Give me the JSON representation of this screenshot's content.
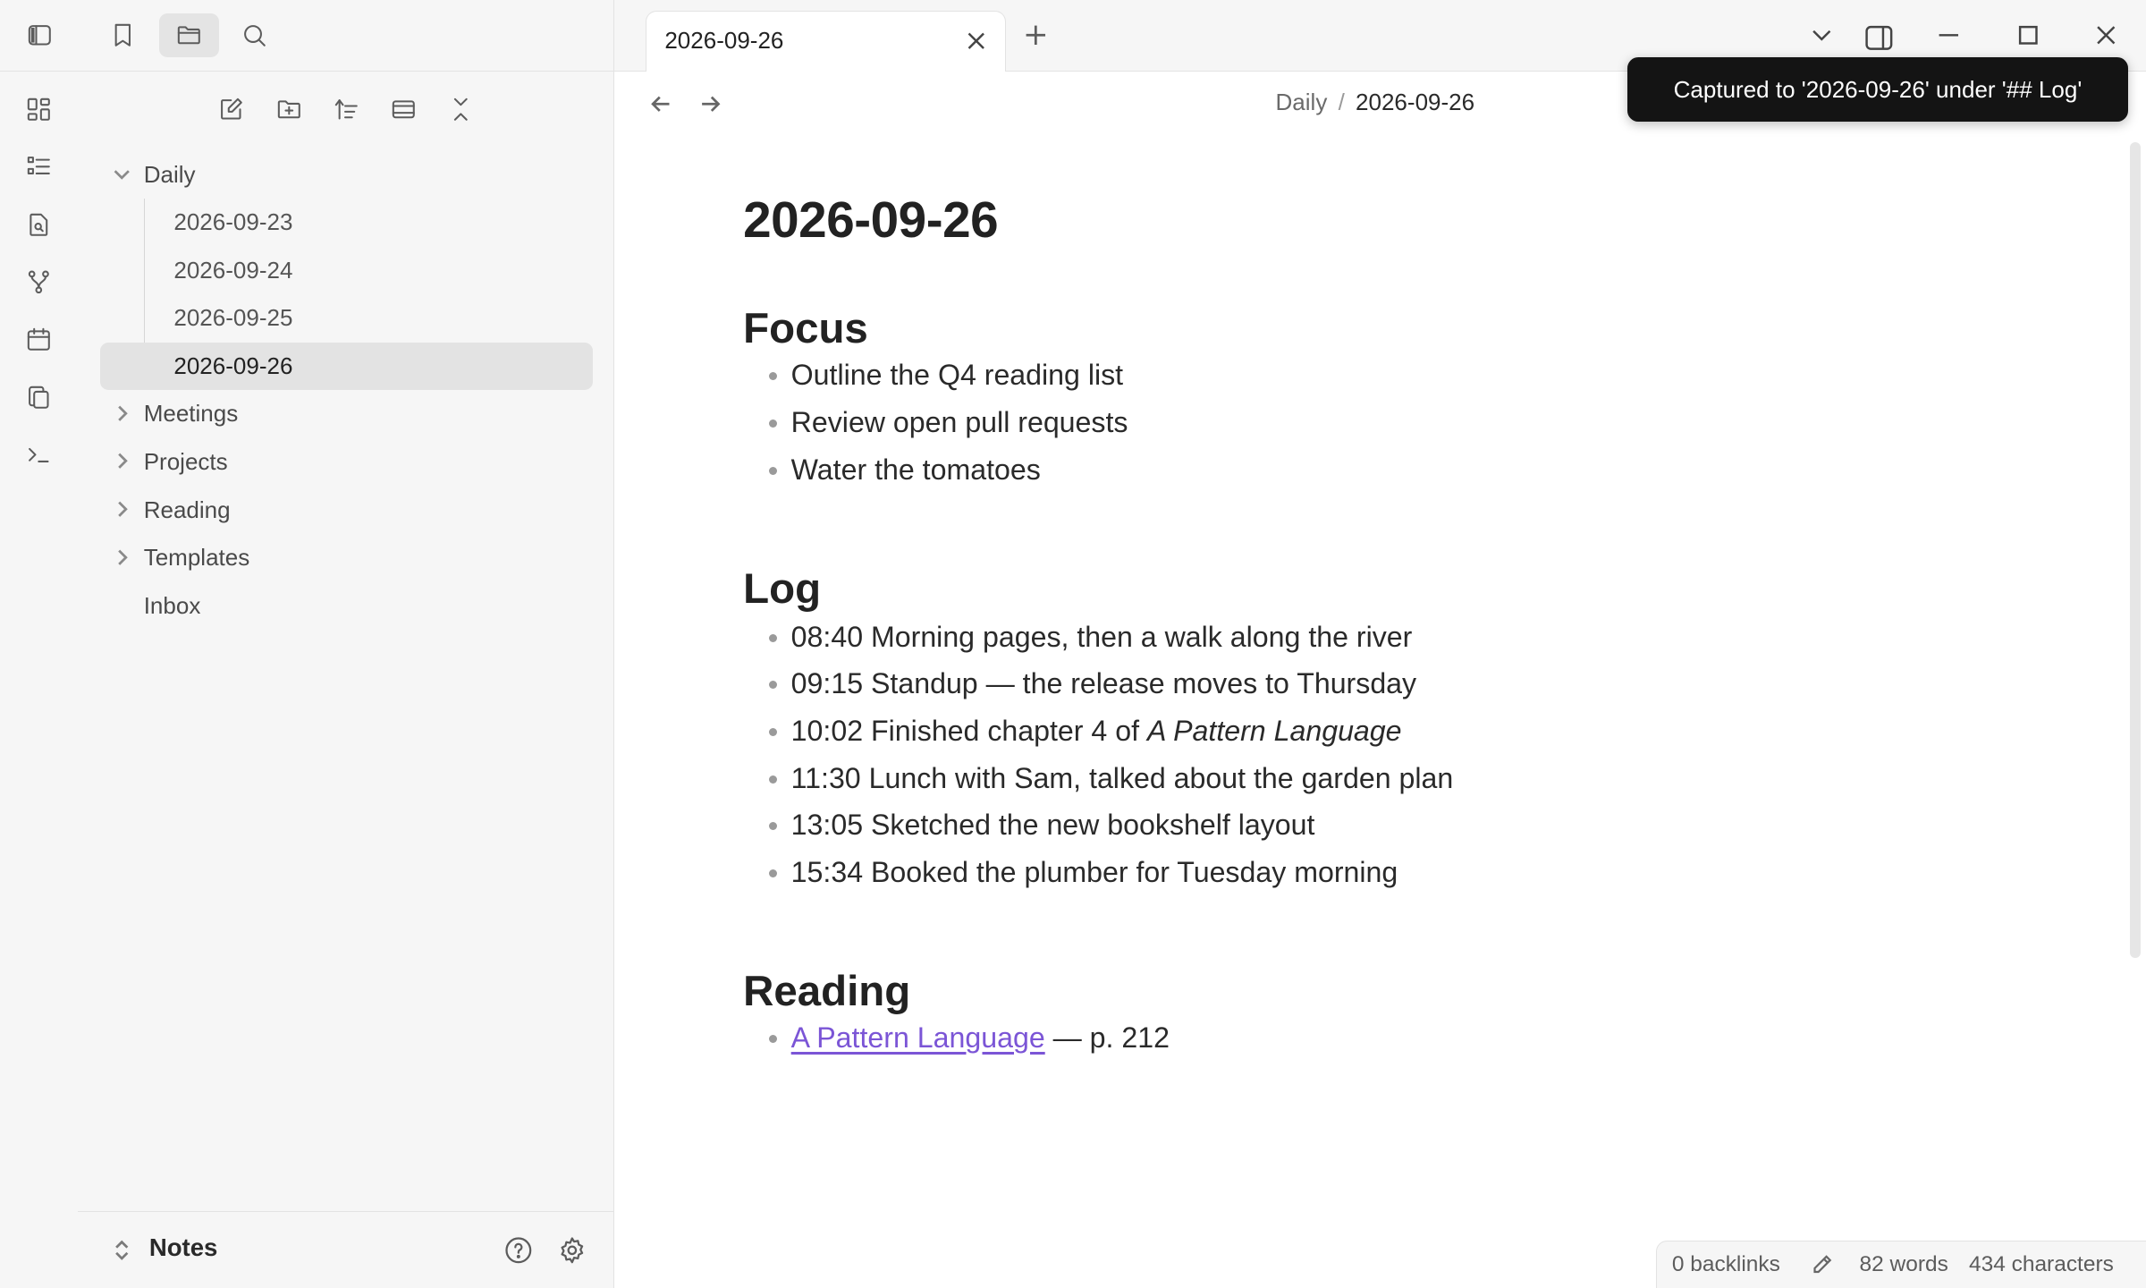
{
  "tab": {
    "title": "2026-09-26"
  },
  "breadcrumb": {
    "folder": "Daily",
    "separator": "/",
    "current": "2026-09-26"
  },
  "toast": {
    "message": "Captured to '2026-09-26' under '## Log'"
  },
  "sidebar": {
    "tree": [
      {
        "label": "Daily",
        "expanded": true
      },
      {
        "label": "2026-09-23"
      },
      {
        "label": "2026-09-24"
      },
      {
        "label": "2026-09-25"
      },
      {
        "label": "2026-09-26",
        "selected": true
      },
      {
        "label": "Meetings"
      },
      {
        "label": "Projects"
      },
      {
        "label": "Reading"
      },
      {
        "label": "Templates"
      },
      {
        "label": "Inbox"
      }
    ],
    "vault_name": "Notes"
  },
  "doc": {
    "title": "2026-09-26",
    "sections": [
      {
        "heading": "Focus",
        "items": [
          "Outline the Q4 reading list",
          "Review open pull requests",
          "Water the tomatoes"
        ]
      },
      {
        "heading": "Log",
        "items": [
          "08:40 Morning pages, then a walk along the river",
          "09:15 Standup — the release moves to Thursday",
          {
            "prefix": "10:02 Finished chapter 4 of ",
            "em": "A Pattern Language"
          },
          "11:30 Lunch with Sam, talked about the garden plan",
          "13:05 Sketched the new bookshelf layout",
          "15:34 Booked the plumber for Tuesday morning"
        ]
      },
      {
        "heading": "Reading",
        "items": [
          {
            "link": "A Pattern Language",
            "suffix": " — p. 212"
          }
        ]
      }
    ]
  },
  "status": {
    "backlinks": "0 backlinks",
    "words": "82 words",
    "characters": "434 characters"
  },
  "colors": {
    "accent_link": "#7b55d6",
    "toast_bg": "#141414",
    "sidebar_bg": "#f6f6f6",
    "selected_row": "#e3e3e3"
  }
}
